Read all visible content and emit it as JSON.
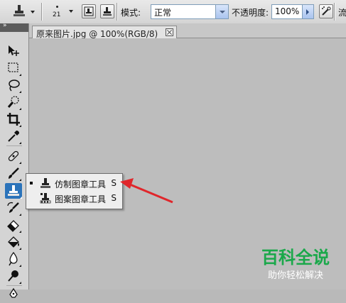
{
  "options_bar": {
    "brush_size": "21",
    "mode_label": "模式:",
    "mode_value": "正常",
    "opacity_label": "不透明度:",
    "opacity_value": "100%",
    "flow_label_partial": "流"
  },
  "tools_panel": {
    "collapse_glyph": "»",
    "tools": [
      {
        "name": "move-tool",
        "icon": "move-icon"
      },
      {
        "name": "marquee-tool",
        "icon": "rect-marquee-icon"
      },
      {
        "name": "lasso-tool",
        "icon": "lasso-icon"
      },
      {
        "name": "quick-selection-tool",
        "icon": "quick-select-icon"
      },
      {
        "name": "crop-tool",
        "icon": "crop-icon"
      },
      {
        "name": "eyedropper-tool",
        "icon": "eyedropper-icon"
      },
      {
        "name": "healing-brush-tool",
        "icon": "bandage-icon"
      },
      {
        "name": "brush-tool",
        "icon": "brush-icon"
      },
      {
        "name": "clone-stamp-tool",
        "icon": "stamp-icon",
        "active": true
      },
      {
        "name": "history-brush-tool",
        "icon": "history-brush-icon"
      },
      {
        "name": "eraser-tool",
        "icon": "eraser-icon"
      },
      {
        "name": "paint-bucket-tool",
        "icon": "bucket-icon"
      },
      {
        "name": "blur-tool",
        "icon": "blur-icon"
      },
      {
        "name": "dodge-tool",
        "icon": "dodge-icon"
      },
      {
        "name": "pen-tool",
        "icon": "pen-icon"
      }
    ]
  },
  "document": {
    "tab_title": "原来图片.jpg @ 100%(RGB/8)"
  },
  "flyout": {
    "items": [
      {
        "label": "仿制图章工具",
        "shortcut": "S",
        "selected": true
      },
      {
        "label": "图案图章工具",
        "shortcut": "S",
        "selected": false
      }
    ]
  },
  "watermark": {
    "title": "百科全说",
    "subtitle": "助你轻松解决"
  },
  "colors": {
    "accent_active_tool": "#2b73ba",
    "arrow_red": "#e0262b",
    "watermark_green": "#1aa84a"
  }
}
